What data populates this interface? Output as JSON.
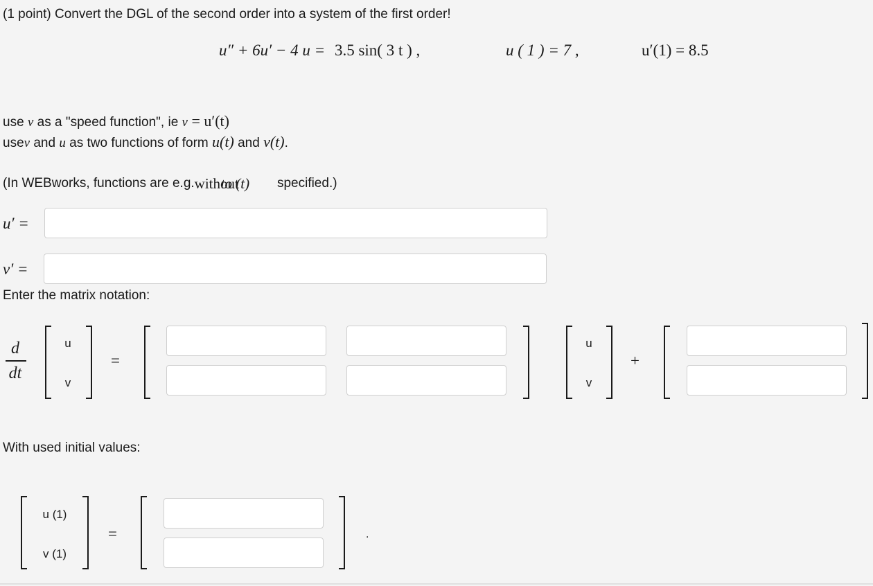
{
  "problem": {
    "header": "(1 point) Convert the DGL of the second order into a system of the first order!",
    "equation": {
      "ode_lhs": "u″ + 6u′  −  4 u  =",
      "ode_rhs": "3.5 sin( 3 t ) ,",
      "ic1": "u ( 1 )  =  7 ,",
      "ic2": "u′(1) = 8.5"
    },
    "instr1": {
      "prefix": "use ",
      "var_v": "v",
      "middle": " as a \"speed function\", ie ",
      "var_v2": "v",
      "expr": " = u′(t)"
    },
    "instr2": {
      "prefix": "use",
      "var_v": "v",
      "mid1": " and ",
      "var_u": "u",
      "mid2": " as two functions of form ",
      "u_t": "u(t)",
      "mid3": " and ",
      "v_t": "v(t)",
      "suffix": "."
    },
    "note": {
      "prefix": "(In WEBworks, functions are e.g.",
      "overlap_a": "without",
      "overlap_b": "to (t)",
      "suffix": " specified.)"
    }
  },
  "system": {
    "u_prime_label": "u′  =",
    "v_prime_label": "v′  =",
    "u_prime_value": "",
    "v_prime_value": ""
  },
  "matrix_section": {
    "heading": "Enter the matrix notation:",
    "deriv_num": "d",
    "deriv_den": "dt",
    "vec_u": "u",
    "vec_v": "v",
    "equals": "=",
    "plus": "+",
    "a11": "",
    "a12": "",
    "a21": "",
    "a22": "",
    "b1": "",
    "b2": ""
  },
  "initial_section": {
    "heading": "With used initial values:",
    "row1": "u (1)",
    "row2": "v (1)",
    "equals": "=",
    "val1": "",
    "val2": "",
    "period": "."
  }
}
